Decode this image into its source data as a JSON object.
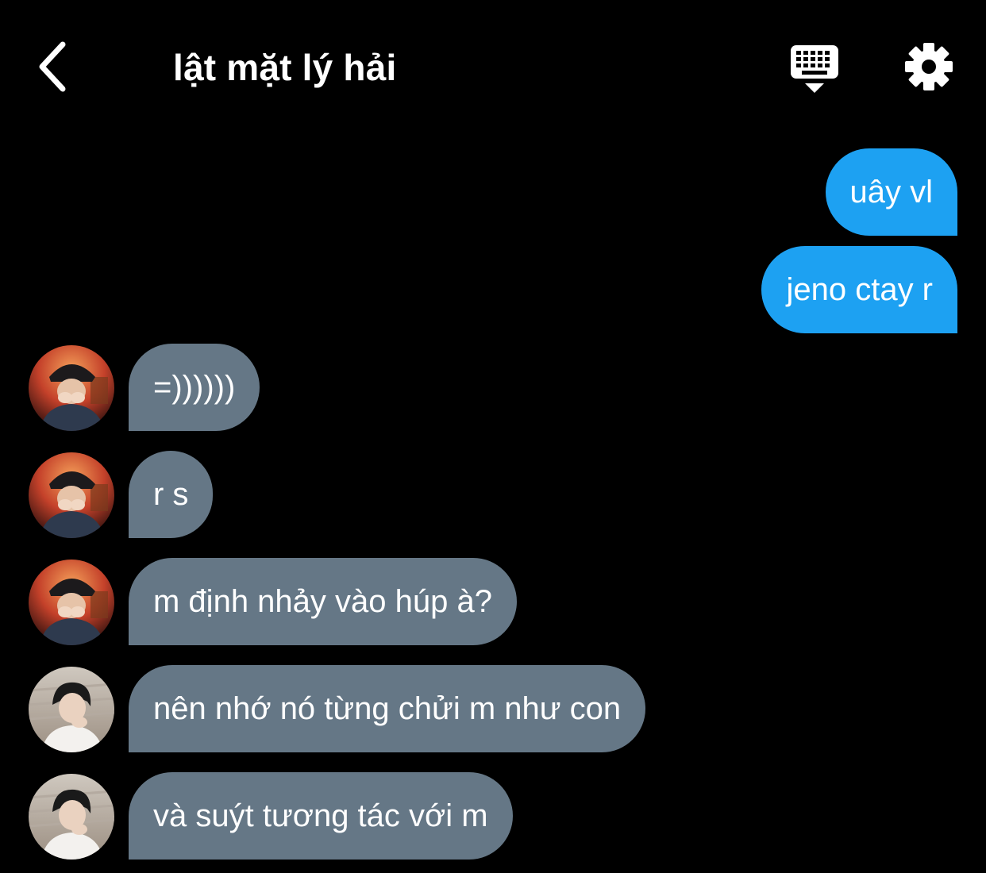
{
  "header": {
    "title": "lật mặt lý hải",
    "back_icon": "chevron-left-icon",
    "keyboard_icon": "keyboard-icon",
    "settings_icon": "gear-icon"
  },
  "colors": {
    "background": "#000000",
    "outgoing_bubble": "#1da1f2",
    "incoming_bubble": "#657786",
    "text": "#ffffff"
  },
  "messages": [
    {
      "direction": "outgoing",
      "text": "uây vl"
    },
    {
      "direction": "outgoing",
      "text": "jeno ctay r"
    },
    {
      "direction": "incoming",
      "avatar": "avatar-user-a",
      "text": "=))))))"
    },
    {
      "direction": "incoming",
      "avatar": "avatar-user-a",
      "text": "r s"
    },
    {
      "direction": "incoming",
      "avatar": "avatar-user-a",
      "text": "m định nhảy vào húp à?"
    },
    {
      "direction": "incoming",
      "avatar": "avatar-user-b",
      "text": "nên nhớ nó từng chửi m như con"
    },
    {
      "direction": "incoming",
      "avatar": "avatar-user-b",
      "text": "và suýt tương tác với m"
    }
  ]
}
